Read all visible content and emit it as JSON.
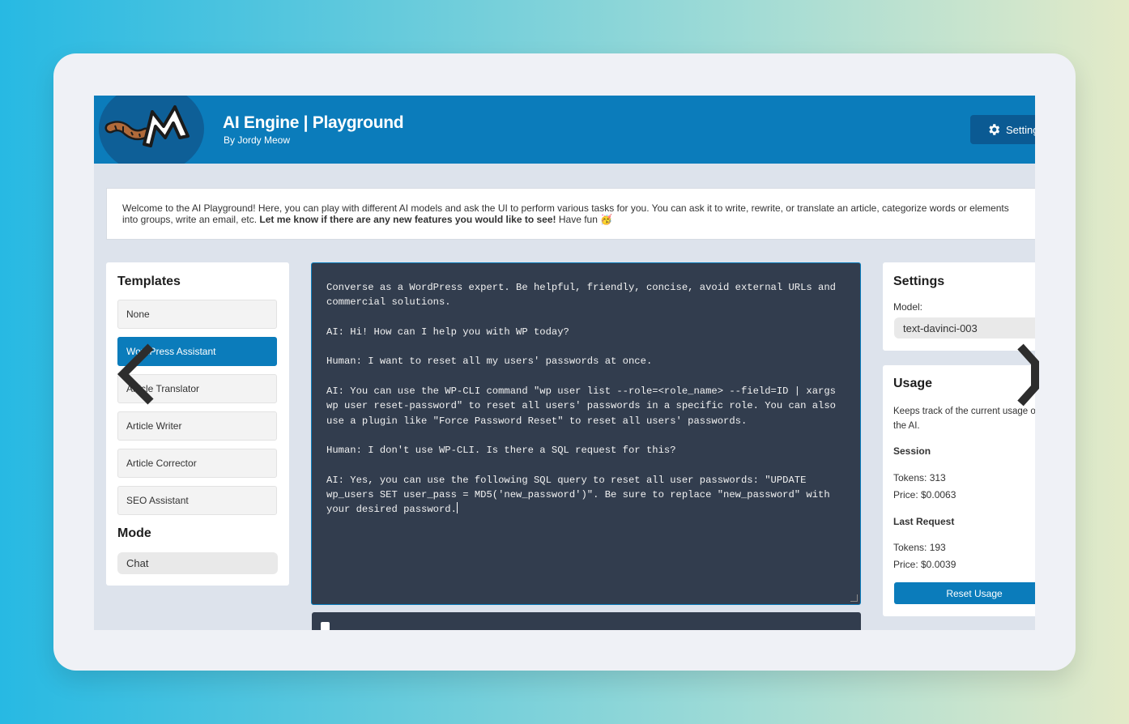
{
  "header": {
    "title": "AI Engine | Playground",
    "subtitle": "By Jordy Meow",
    "settings_label": "Settings",
    "logo_letter": "M"
  },
  "welcome": {
    "text_start": "Welcome to the AI Playground! Here, you can play with different AI models and ask the UI to perform various tasks for you. You can ask it to write, rewrite, or translate an article, categorize words or elements",
    "text_line2": "into groups, write an email, etc.",
    "bold_text": "Let me know if there are any new features you would like to see!",
    "text_end": "Have fun",
    "emoji": "🥳"
  },
  "templates": {
    "title": "Templates",
    "items": [
      {
        "label": "None",
        "active": false
      },
      {
        "label": "WordPress Assistant",
        "active": true
      },
      {
        "label": "Article Translator",
        "active": false
      },
      {
        "label": "Article Writer",
        "active": false
      },
      {
        "label": "Article Corrector",
        "active": false
      },
      {
        "label": "SEO Assistant",
        "active": false
      }
    ],
    "mode_title": "Mode",
    "mode_value": "Chat"
  },
  "editor": {
    "paragraphs": [
      "Converse as a WordPress expert. Be helpful, friendly, concise, avoid external URLs and commercial solutions.",
      "AI: Hi! How can I help you with WP today?",
      "Human: I want to reset all my users' passwords at once.",
      "AI: You can use the WP-CLI command \"wp user list --role=<role_name> --field=ID | xargs wp user reset-password\" to reset all users' passwords in a specific role. You can also use a plugin like \"Force Password Reset\" to reset all users' passwords.",
      "Human: I don't use WP-CLI. Is there a SQL request for this?",
      "AI: Yes, you can use the following SQL query to reset all user passwords: \"UPDATE wp_users SET user_pass = MD5('new_password')\". Be sure to replace \"new_password\" with your desired password."
    ]
  },
  "settings": {
    "title": "Settings",
    "model_label": "Model:",
    "model_value": "text-davinci-003"
  },
  "usage": {
    "title": "Usage",
    "description": "Keeps track of the current usage of the AI.",
    "session_title": "Session",
    "session_tokens": "Tokens: 313",
    "session_price": "Price: $0.0063",
    "last_title": "Last Request",
    "last_tokens": "Tokens: 193",
    "last_price": "Price: $0.0039",
    "reset_label": "Reset Usage"
  },
  "colors": {
    "brand": "#0b7cbb",
    "editor_bg": "#323d4e"
  }
}
